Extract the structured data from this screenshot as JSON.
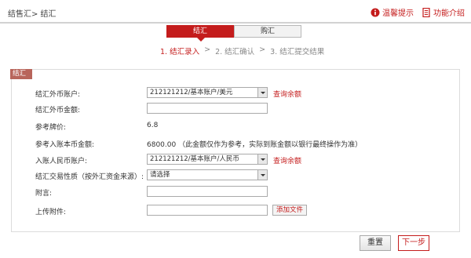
{
  "header": {
    "breadcrumb": "结售汇> 结汇",
    "tips_label": "温馨提示",
    "intro_label": "功能介绍"
  },
  "tabs": [
    {
      "label": "结汇",
      "active": true
    },
    {
      "label": "购汇",
      "active": false
    }
  ],
  "steps": {
    "step1": "1. 结汇录入",
    "sep1": ">",
    "step2": "2. 结汇确认",
    "sep2": ">",
    "step3": "3. 结汇提交结果"
  },
  "panel": {
    "tag": "结汇",
    "fields": {
      "fx_account_label": "结汇外币账户:",
      "fx_account_value": "212121212/基本账户/美元",
      "query_balance_1": "查询余额",
      "fx_amount_label": "结汇外币金额:",
      "ref_rate_label": "参考牌价:",
      "ref_rate_value": "6.8",
      "ref_amount_label": "参考入账本币金额:",
      "ref_amount_value": "6800.00  （此金额仅作为参考，实际到账金额以银行最终操作为准）",
      "rmb_account_label": "入账人民币账户:",
      "rmb_account_value": "212121212/基本账户/人民币",
      "query_balance_2": "查询余额",
      "tx_nature_label": "结汇交易性质（按外汇资金来源）:",
      "tx_nature_value": "请选择",
      "note_label": "附言:",
      "upload_label": "上传附件:",
      "add_file_label": "添加文件"
    }
  },
  "buttons": {
    "reset": "重置",
    "next": "下一步"
  },
  "colors": {
    "accent": "#c41c1c",
    "tag_bg": "#b8655b"
  }
}
